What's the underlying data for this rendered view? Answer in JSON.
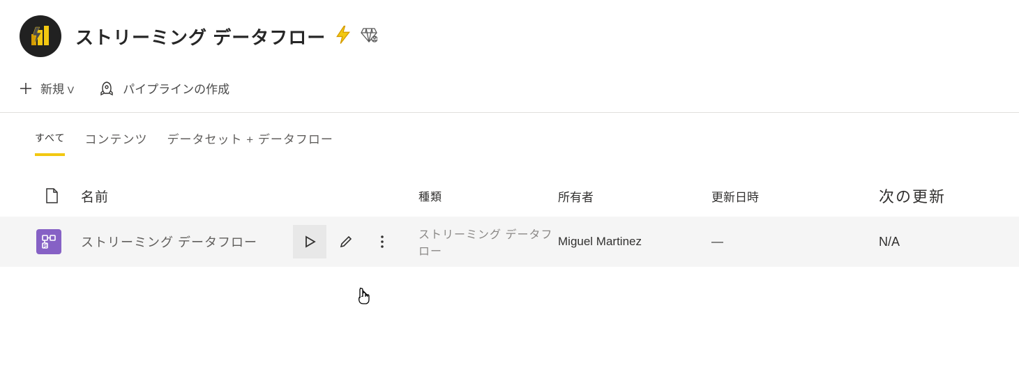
{
  "header": {
    "title": "ストリーミング データフロー"
  },
  "toolbar": {
    "new_label": "新規",
    "pipeline_label": "パイプラインの作成"
  },
  "tabs": [
    {
      "label": "すべて",
      "active": true
    },
    {
      "label": "コンテンツ",
      "active": false
    },
    {
      "label": "データセット + データフロー",
      "active": false
    }
  ],
  "columns": {
    "name": "名前",
    "type": "種類",
    "owner": "所有者",
    "updated": "更新日時",
    "next": "次の更新"
  },
  "rows": [
    {
      "name": "ストリーミング データフロー",
      "type": "ストリーミング データフロー",
      "owner": "Miguel Martinez",
      "updated": "—",
      "next": "N/A"
    }
  ]
}
